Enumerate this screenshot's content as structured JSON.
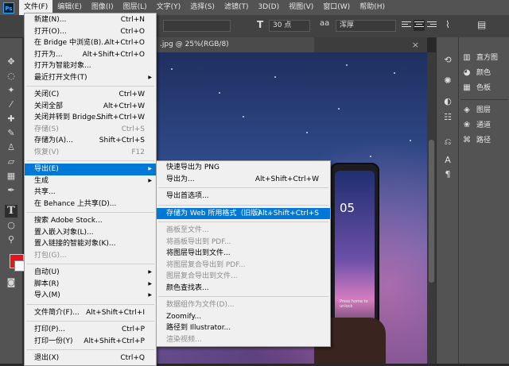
{
  "app": {
    "logo": "Ps"
  },
  "menubar": [
    "文件(F)",
    "编辑(E)",
    "图像(I)",
    "图层(L)",
    "文字(Y)",
    "选择(S)",
    "滤镜(T)",
    "3D(D)",
    "视图(V)",
    "窗口(W)",
    "帮助(H)"
  ],
  "options": {
    "font_size": "30 点",
    "antialias": "浑厚",
    "font_size_icon": "T",
    "aa_icon": "aa"
  },
  "tab": {
    "title": ".jpg @ 25%(RGB/8)",
    "close": "×"
  },
  "phone": {
    "time": "05",
    "hint": "Press home to unlock"
  },
  "panels": [
    {
      "icon": "histogram-icon",
      "label": "直方图"
    },
    {
      "icon": "color-icon",
      "label": "颜色"
    },
    {
      "icon": "swatches-icon",
      "label": "色板"
    },
    {
      "icon": "layers-icon",
      "label": "图层"
    },
    {
      "icon": "channels-icon",
      "label": "通道"
    },
    {
      "icon": "paths-icon",
      "label": "路径"
    }
  ],
  "file_menu": [
    {
      "label": "新建(N)...",
      "shortcut": "Ctrl+N"
    },
    {
      "label": "打开(O)...",
      "shortcut": "Ctrl+O"
    },
    {
      "label": "在 Bridge 中浏览(B)...",
      "shortcut": "Alt+Ctrl+O"
    },
    {
      "label": "打开为...",
      "shortcut": "Alt+Shift+Ctrl+O"
    },
    {
      "label": "打开为智能对象..."
    },
    {
      "label": "最近打开文件(T)",
      "submenu": true
    },
    {
      "sep": true
    },
    {
      "label": "关闭(C)",
      "shortcut": "Ctrl+W"
    },
    {
      "label": "关闭全部",
      "shortcut": "Alt+Ctrl+W"
    },
    {
      "label": "关闭并转到 Bridge...",
      "shortcut": "Shift+Ctrl+W"
    },
    {
      "label": "存储(S)",
      "shortcut": "Ctrl+S",
      "disabled": true
    },
    {
      "label": "存储为(A)...",
      "shortcut": "Shift+Ctrl+S"
    },
    {
      "label": "恢复(V)",
      "shortcut": "F12",
      "disabled": true
    },
    {
      "sep": true
    },
    {
      "label": "导出(E)",
      "submenu": true,
      "highlighted": true
    },
    {
      "label": "生成",
      "submenu": true
    },
    {
      "label": "共享..."
    },
    {
      "label": "在 Behance 上共享(D)..."
    },
    {
      "sep": true
    },
    {
      "label": "搜索 Adobe Stock..."
    },
    {
      "label": "置入嵌入对象(L)..."
    },
    {
      "label": "置入链接的智能对象(K)..."
    },
    {
      "label": "打包(G)...",
      "disabled": true
    },
    {
      "sep": true
    },
    {
      "label": "自动(U)",
      "submenu": true
    },
    {
      "label": "脚本(R)",
      "submenu": true
    },
    {
      "label": "导入(M)",
      "submenu": true
    },
    {
      "sep": true
    },
    {
      "label": "文件简介(F)...",
      "shortcut": "Alt+Shift+Ctrl+I"
    },
    {
      "sep": true
    },
    {
      "label": "打印(P)...",
      "shortcut": "Ctrl+P"
    },
    {
      "label": "打印一份(Y)",
      "shortcut": "Alt+Shift+Ctrl+P"
    },
    {
      "sep": true
    },
    {
      "label": "退出(X)",
      "shortcut": "Ctrl+Q"
    }
  ],
  "export_menu": [
    {
      "label": "快速导出为 PNG"
    },
    {
      "label": "导出为...",
      "shortcut": "Alt+Shift+Ctrl+W"
    },
    {
      "sep": true
    },
    {
      "label": "导出首选项..."
    },
    {
      "sep": true
    },
    {
      "label": "存储为 Web 所用格式（旧版）...",
      "shortcut": "Alt+Shift+Ctrl+S",
      "highlighted": true
    },
    {
      "sep": true
    },
    {
      "label": "画板至文件...",
      "disabled": true
    },
    {
      "label": "将画板导出到 PDF...",
      "disabled": true
    },
    {
      "label": "将图层导出到文件..."
    },
    {
      "label": "将图层复合导出到 PDF...",
      "disabled": true
    },
    {
      "label": "图层复合导出到文件...",
      "disabled": true
    },
    {
      "label": "颜色查找表..."
    },
    {
      "sep": true
    },
    {
      "label": "数据组作为文件(D)...",
      "disabled": true
    },
    {
      "label": "Zoomify..."
    },
    {
      "label": "路径到 Illustrator..."
    },
    {
      "label": "渲染视频...",
      "disabled": true
    }
  ]
}
